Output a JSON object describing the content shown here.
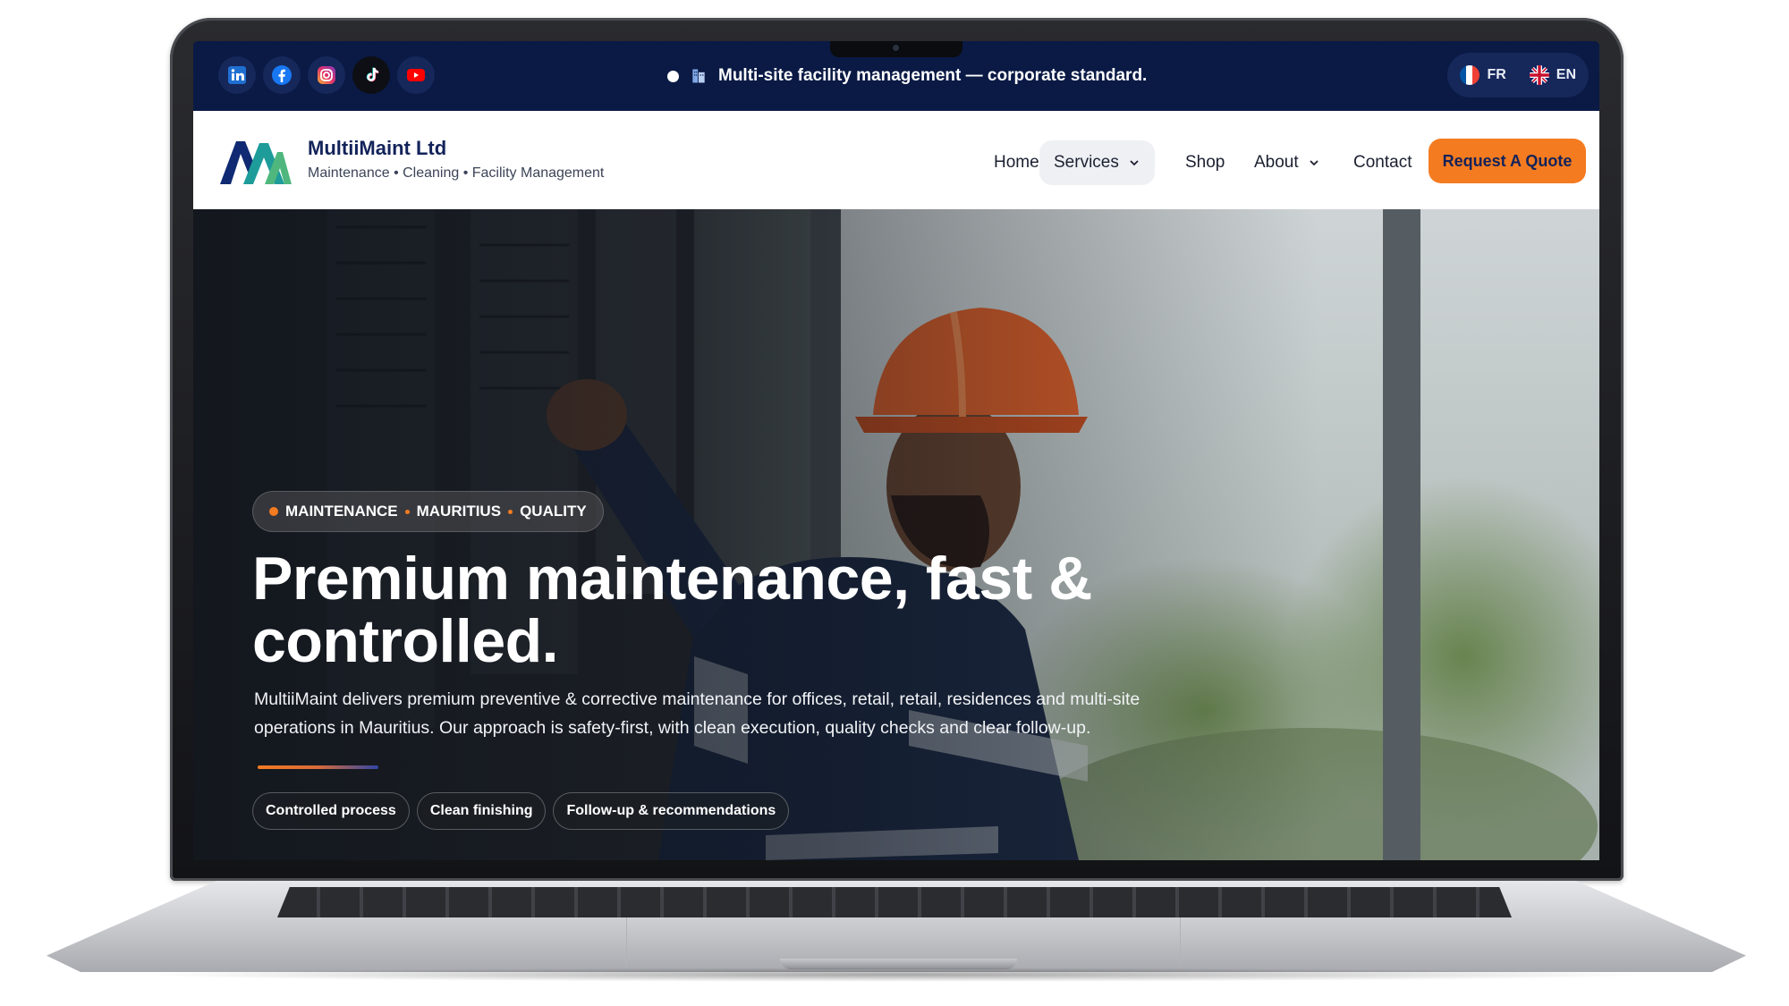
{
  "topbar": {
    "socials": [
      {
        "icon": "linkedin-icon"
      },
      {
        "icon": "facebook-icon"
      },
      {
        "icon": "instagram-icon"
      },
      {
        "icon": "tiktok-icon"
      },
      {
        "icon": "youtube-icon"
      }
    ],
    "announcement": "Multi-site facility management — corporate standard.",
    "languages": [
      {
        "code": "FR"
      },
      {
        "code": "EN"
      }
    ]
  },
  "nav": {
    "brand_name": "MultiiMaint Ltd",
    "brand_tagline": "Maintenance • Cleaning • Facility Management",
    "menu": {
      "home": "Home",
      "services": "Services",
      "shop": "Shop",
      "about": "About",
      "contact": "Contact"
    },
    "cta": "Request A Quote"
  },
  "hero": {
    "eyebrow": [
      "MAINTENANCE",
      "MAURITIUS",
      "QUALITY"
    ],
    "title_line1": "Premium maintenance, fast &",
    "title_line2": "controlled.",
    "description": "MultiiMaint delivers premium preventive & corrective maintenance for offices, retail, retail, residences and multi-site operations in Mauritius. Our approach is safety-first, with clean execution, quality checks and clear follow-up.",
    "chips": [
      "Controlled process",
      "Clean finishing",
      "Follow-up & recommendations"
    ]
  },
  "colors": {
    "navy": "#0a1a45",
    "accent_orange": "#f47b20",
    "brand_text": "#13235a"
  }
}
